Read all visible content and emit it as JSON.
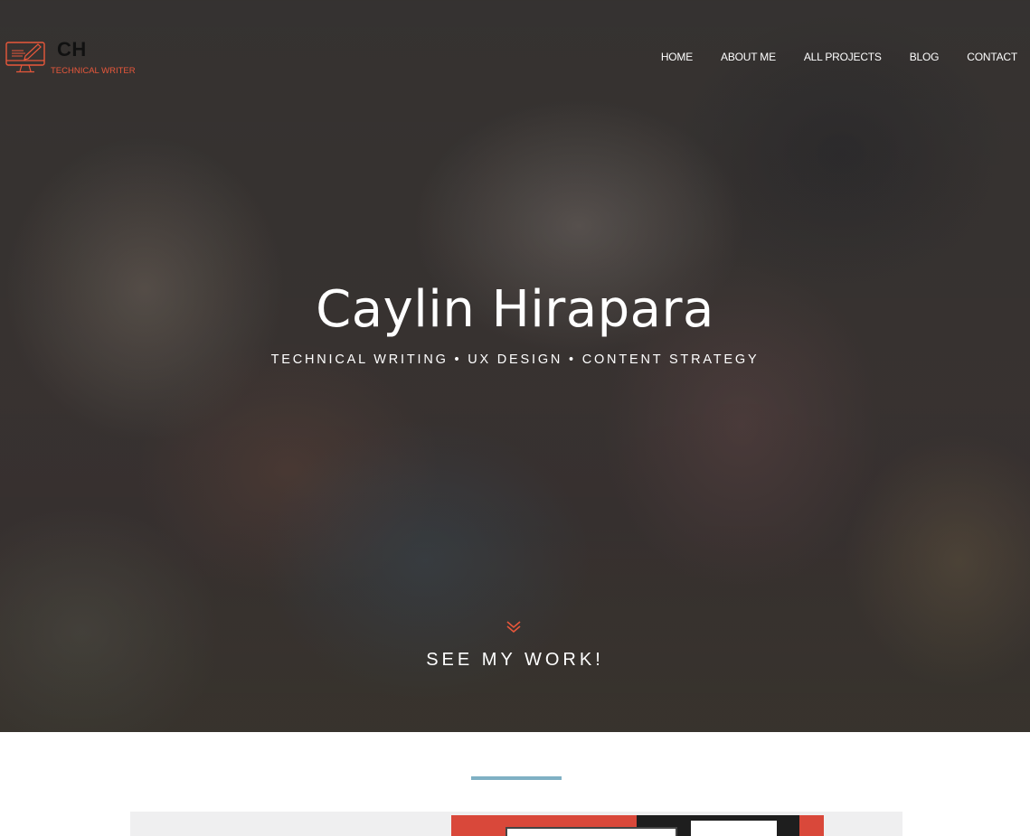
{
  "header": {
    "logo_mark": "CH",
    "logo_subtitle": "TECHNICAL WRITER",
    "logo_icon": "computer-pen-icon",
    "nav": [
      {
        "label": "HOME"
      },
      {
        "label": "ABOUT ME"
      },
      {
        "label": "ALL PROJECTS"
      },
      {
        "label": "BLOG"
      },
      {
        "label": "CONTACT"
      }
    ]
  },
  "hero": {
    "title": "Caylin Hirapara",
    "tagline": "TECHNICAL WRITING • UX DESIGN • CONTENT STRATEGY",
    "scroll_icon": "double-chevron-down-icon",
    "scroll_label": "SEE MY WORK!"
  },
  "colors": {
    "accent": "#e8573b",
    "divider": "#7fb0c4",
    "hero_text": "#ffffff"
  }
}
